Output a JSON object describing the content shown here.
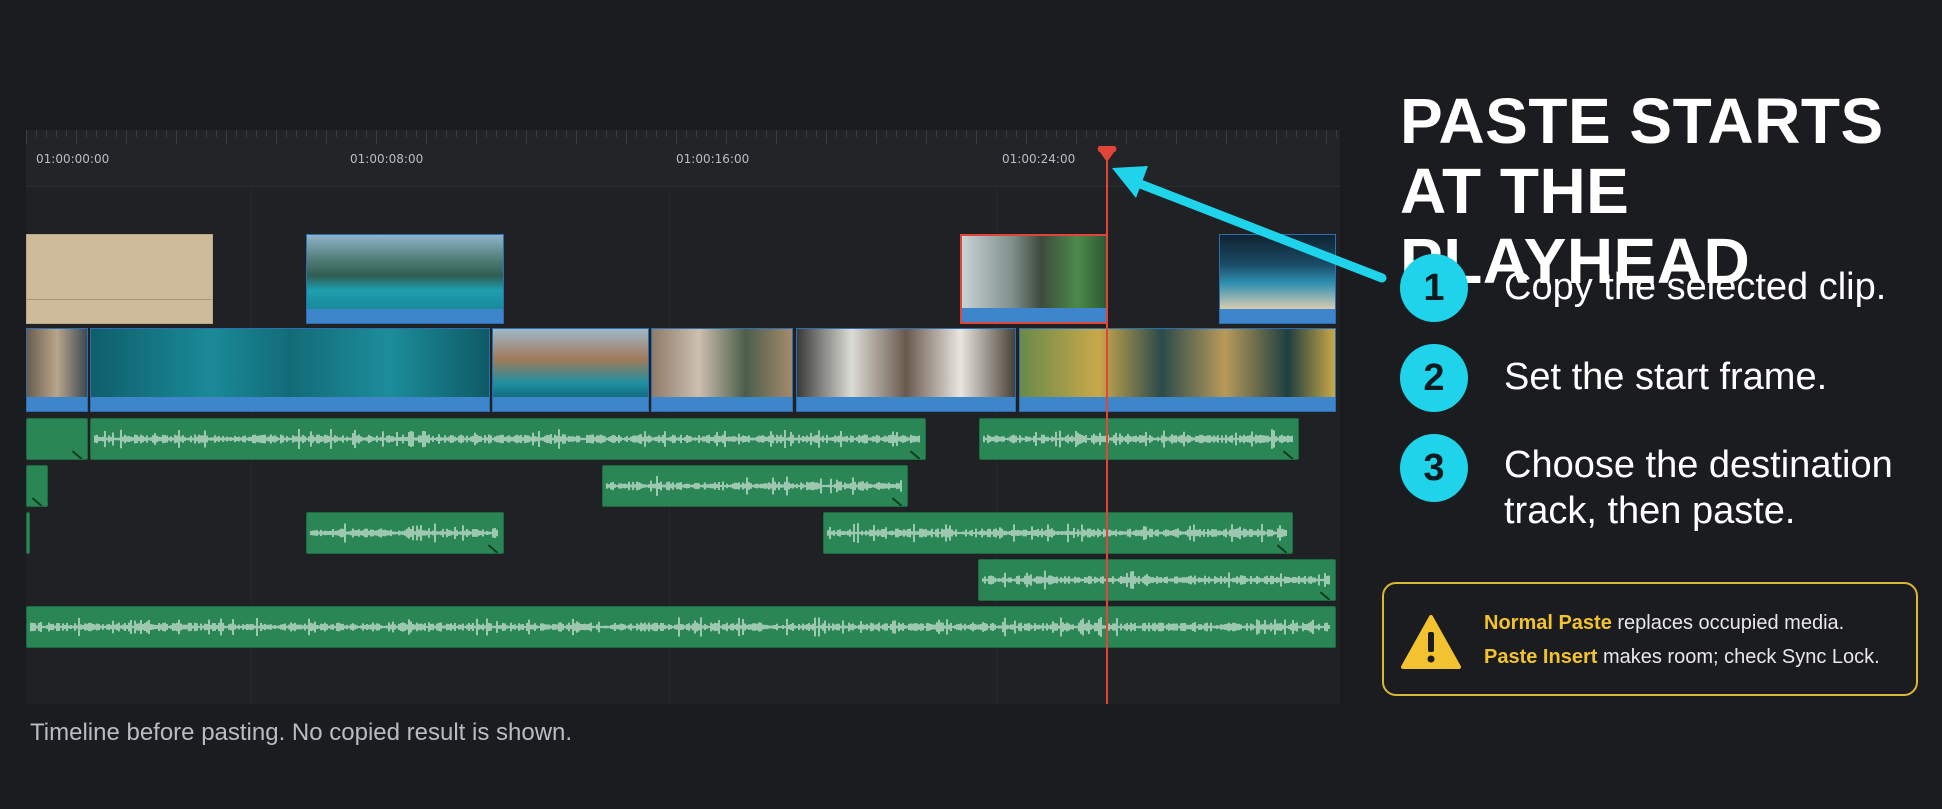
{
  "timeline": {
    "timecodes": [
      "01:00:00:00",
      "01:00:08:00",
      "01:00:16:00",
      "01:00:24:00"
    ],
    "caption": "Timeline before pasting. No copied result is shown."
  },
  "panel": {
    "title_line1": "PASTE STARTS",
    "title_line2": "AT THE PLAYHEAD",
    "steps": [
      {
        "num": "1",
        "text": "Copy the selected clip."
      },
      {
        "num": "2",
        "text": "Set the start frame."
      },
      {
        "num": "3",
        "text_line1": "Choose the destination",
        "text_line2": "track, then paste."
      }
    ],
    "warning": {
      "line1_highlight": "Normal Paste",
      "line1_rest": " replaces occupied media.",
      "line2_highlight": "Paste Insert",
      "line2_rest": " makes room; check Sync Lock."
    }
  },
  "colors": {
    "accent_cyan": "#1fd4ea",
    "playhead_red": "#e0453a",
    "warning_yellow": "#f2c230",
    "audio_green": "#2b8656",
    "video_blue": "#3d86cc"
  },
  "icons": {
    "warning": "warning-triangle-icon",
    "pointer": "arrow-icon"
  }
}
